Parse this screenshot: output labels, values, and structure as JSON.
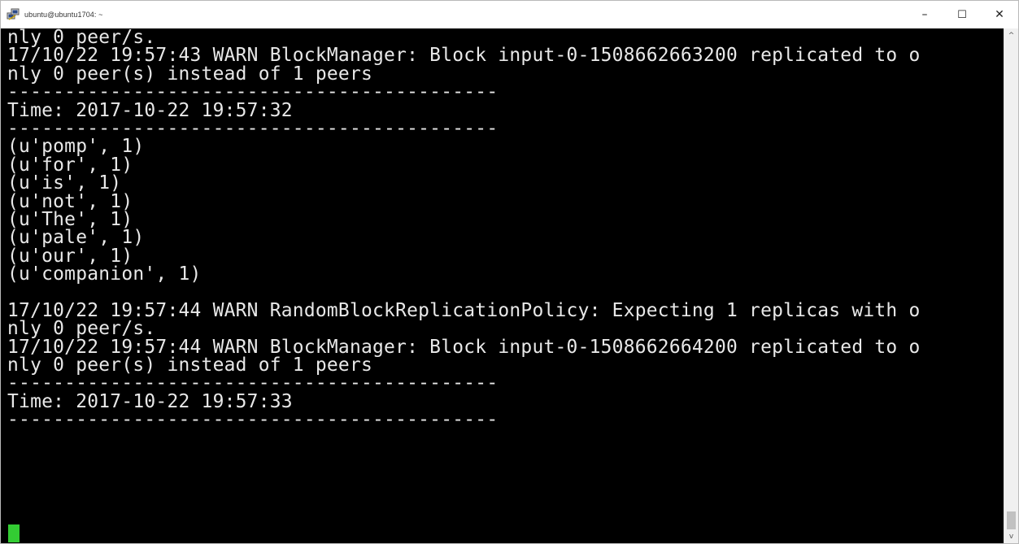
{
  "window": {
    "title": "ubuntu@ubuntu1704: ~",
    "minimize_glyph": "–",
    "maximize_glyph": "☐",
    "close_glyph": "✕",
    "app_icon": "putty-icon"
  },
  "terminal": {
    "lines": [
      "nly 0 peer/s.",
      "17/10/22 19:57:43 WARN BlockManager: Block input-0-1508662663200 replicated to o",
      "nly 0 peer(s) instead of 1 peers",
      "-------------------------------------------",
      "Time: 2017-10-22 19:57:32",
      "-------------------------------------------",
      "(u'pomp', 1)",
      "(u'for', 1)",
      "(u'is', 1)",
      "(u'not', 1)",
      "(u'The', 1)",
      "(u'pale', 1)",
      "(u'our', 1)",
      "(u'companion', 1)",
      "",
      "17/10/22 19:57:44 WARN RandomBlockReplicationPolicy: Expecting 1 replicas with o",
      "nly 0 peer/s.",
      "17/10/22 19:57:44 WARN BlockManager: Block input-0-1508662664200 replicated to o",
      "nly 0 peer(s) instead of 1 peers",
      "-------------------------------------------",
      "Time: 2017-10-22 19:57:33",
      "-------------------------------------------",
      "",
      "",
      ""
    ],
    "text_color": "#e8e8e8",
    "background_color": "#000000",
    "cursor_color": "#33cc33"
  },
  "scrollbar": {
    "up_glyph": "^",
    "down_glyph": "v"
  }
}
